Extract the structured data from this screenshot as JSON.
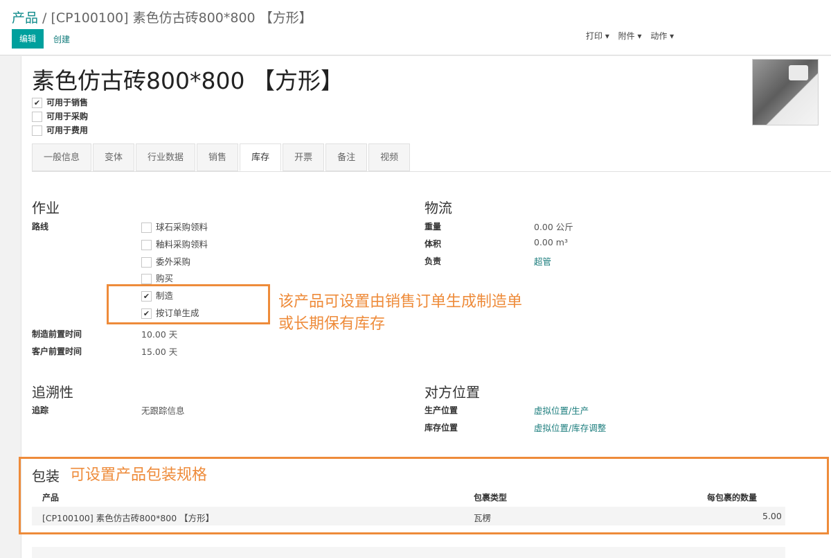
{
  "breadcrumb": {
    "root": "产品",
    "sep": " / ",
    "current": "[CP100100] 素色仿古砖800*800 【方形】"
  },
  "toolbar": {
    "edit": "编辑",
    "create": "创建",
    "print": "打印 ▾",
    "attach": "附件 ▾",
    "action": "动作 ▾"
  },
  "product": {
    "title": "素色仿古砖800*800 【方形】",
    "flags": [
      {
        "label": "可用于销售",
        "checked": true
      },
      {
        "label": "可用于采购",
        "checked": false
      },
      {
        "label": "可用于费用",
        "checked": false
      }
    ]
  },
  "tabs": [
    "一般信息",
    "变体",
    "行业数据",
    "销售",
    "库存",
    "开票",
    "备注",
    "视频"
  ],
  "active_tab": "库存",
  "operations": {
    "heading": "作业",
    "route_label": "路线",
    "routes": [
      {
        "label": "球石采购领料",
        "checked": false
      },
      {
        "label": "釉料采购领料",
        "checked": false
      },
      {
        "label": "委外采购",
        "checked": false
      },
      {
        "label": "购买",
        "checked": false
      },
      {
        "label": "制造",
        "checked": true
      },
      {
        "label": "按订单生成",
        "checked": true
      }
    ],
    "mfg_lead_label": "制造前置时间",
    "mfg_lead_value": "10.00 天",
    "cust_lead_label": "客户前置时间",
    "cust_lead_value": "15.00 天"
  },
  "logistics": {
    "heading": "物流",
    "weight_label": "重量",
    "weight_value": "0.00 公斤",
    "volume_label": "体积",
    "volume_value": "0.00 m³",
    "resp_label": "负责",
    "resp_value": "超管"
  },
  "traceability": {
    "heading": "追溯性",
    "track_label": "追踪",
    "track_value": "无跟踪信息"
  },
  "counterpart": {
    "heading": "对方位置",
    "prod_label": "生产位置",
    "prod_value": "虚拟位置/生产",
    "inv_label": "库存位置",
    "inv_value": "虚拟位置/库存调整"
  },
  "annotations": {
    "route_note_line1": "该产品可设置由销售订单生成制造单",
    "route_note_line2": "或长期保有库存",
    "packaging_note": "可设置产品包装规格"
  },
  "packaging": {
    "heading": "包装",
    "headers": [
      "产品",
      "包裹类型",
      "每包裹的数量"
    ],
    "rows": [
      [
        "[CP100100] 素色仿古砖800*800 【方形】",
        "瓦楞",
        "5.00"
      ]
    ]
  },
  "chart_data": {
    "type": "table",
    "title": "包装",
    "columns": [
      "产品",
      "包裹类型",
      "每包裹的数量"
    ],
    "rows": [
      [
        "[CP100100] 素色仿古砖800*800 【方形】",
        "瓦楞",
        5.0
      ]
    ]
  },
  "colors": {
    "accent": "#00a09d",
    "link": "#1b7d7d",
    "annotation": "#ee8b3a"
  }
}
